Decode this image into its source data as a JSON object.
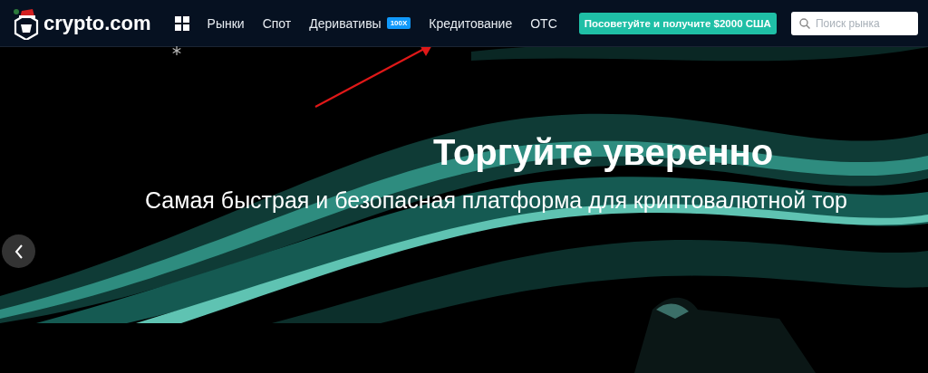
{
  "header": {
    "logo": "crypto.com",
    "nav": [
      {
        "label": "Рынки"
      },
      {
        "label": "Спот"
      },
      {
        "label": "Деривативы",
        "badge": "100X"
      },
      {
        "label": "Кредитование"
      },
      {
        "label": "OTC"
      }
    ],
    "promo_button": "Посоветуйте и получите $2000 США",
    "search": {
      "placeholder": "Поиск рынка"
    }
  },
  "hero": {
    "title": "Торгуйте уверенно",
    "subtitle": "Самая быстрая и безопасная платформа для криптовалютной тор"
  }
}
